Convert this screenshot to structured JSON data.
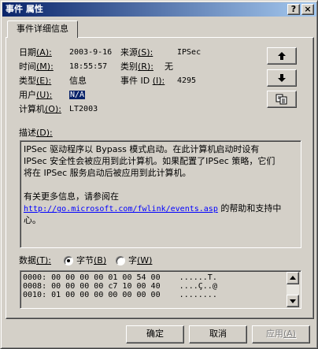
{
  "window": {
    "title": "事件 属性",
    "help_glyph": "?",
    "close_glyph": "×"
  },
  "tab": {
    "label": "事件详细信息"
  },
  "fields": {
    "date_label": "日期",
    "date_key": "(A):",
    "date_value": "2003-9-16",
    "source_label": "来源",
    "source_key": "(S):",
    "source_value": "IPSec",
    "time_label": "时间",
    "time_key": "(M):",
    "time_value": "18:55:57",
    "category_label": "类别",
    "category_key": "(R):",
    "category_value": "无",
    "type_label": "类型",
    "type_key": "(E):",
    "type_value": "信息",
    "eventid_label": "事件 ID",
    "eventid_key": "(I):",
    "eventid_value": "4295",
    "user_label": "用户",
    "user_key": "(U):",
    "user_value": "N/A",
    "computer_label": "计算机",
    "computer_key": "(O):",
    "computer_value": "LT2003"
  },
  "nav": {
    "up_icon": "arrow-up-icon",
    "down_icon": "arrow-down-icon",
    "copy_icon": "copy-icon"
  },
  "description": {
    "label": "描述",
    "key": "(D):",
    "lines": [
      "IPSec 驱动程序以 Bypass 模式启动。在此计算机启动时设有",
      "IPSec 安全性会被应用到此计算机。如果配置了IPSec 策略，它们",
      "将在  IPSec 服务启动后被应用到此计算机。",
      "",
      "有关更多信息，请参阅在"
    ],
    "link": "http://go.microsoft.com/fwlink/events.asp",
    "after_link": " 的帮助和支持中",
    "last_line": "心。"
  },
  "data_section": {
    "label": "数据",
    "key": "(T):",
    "option_bytes": "字节",
    "option_bytes_key": "(B)",
    "option_words": "字",
    "option_words_key": "(W)",
    "selected": "bytes",
    "rows": [
      "0000: 00 00 00 00 01 00 54 00    ......T.",
      "0008: 00 00 00 00 c7 10 00 40    ....Ç..@",
      "0010: 01 00 00 00 00 00 00 00    ........"
    ]
  },
  "buttons": {
    "ok": "确定",
    "cancel": "取消",
    "apply": "应用",
    "apply_key": "(A)"
  }
}
